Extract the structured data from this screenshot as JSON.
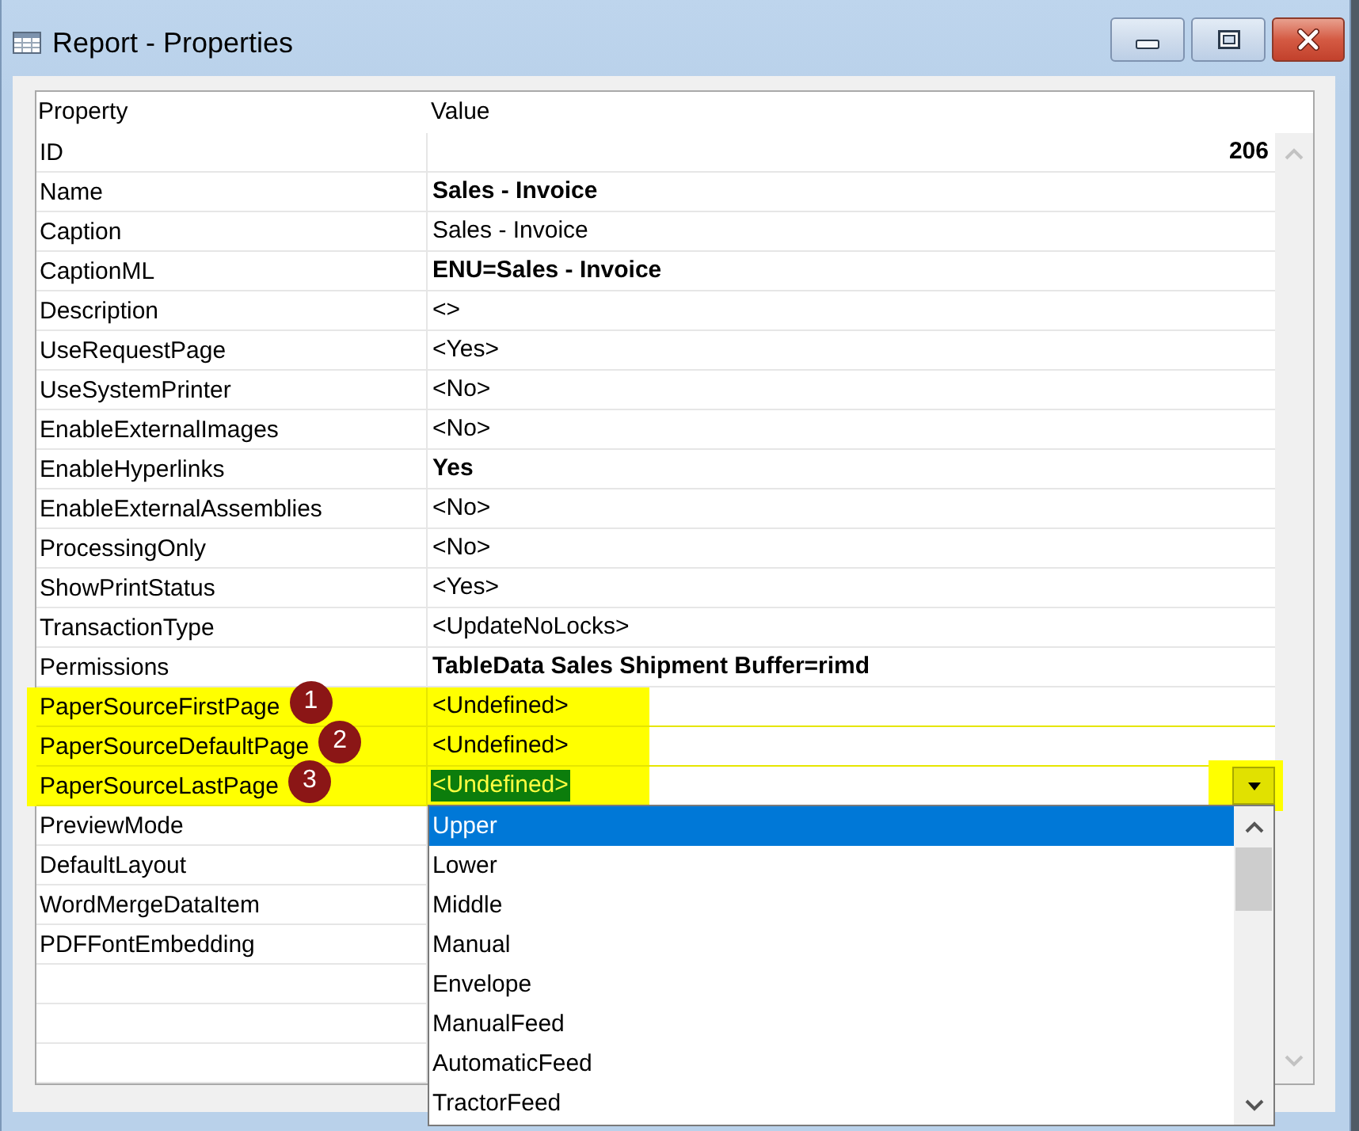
{
  "window": {
    "title": "Report - Properties"
  },
  "properties": {
    "columns": [
      "Property",
      "Value"
    ],
    "rows": [
      {
        "name": "ID",
        "value": "206",
        "kind": "number",
        "bold": true,
        "highlighted": false,
        "selected": false
      },
      {
        "name": "Name",
        "value": "Sales - Invoice",
        "kind": "text",
        "bold": true,
        "highlighted": false,
        "selected": false
      },
      {
        "name": "Caption",
        "value": "Sales - Invoice",
        "kind": "text",
        "bold": false,
        "highlighted": false,
        "selected": false
      },
      {
        "name": "CaptionML",
        "value": "ENU=Sales - Invoice",
        "kind": "text",
        "bold": true,
        "highlighted": false,
        "selected": false
      },
      {
        "name": "Description",
        "value": "<>",
        "kind": "text",
        "bold": false,
        "highlighted": false,
        "selected": false
      },
      {
        "name": "UseRequestPage",
        "value": "<Yes>",
        "kind": "text",
        "bold": false,
        "highlighted": false,
        "selected": false
      },
      {
        "name": "UseSystemPrinter",
        "value": "<No>",
        "kind": "text",
        "bold": false,
        "highlighted": false,
        "selected": false
      },
      {
        "name": "EnableExternalImages",
        "value": "<No>",
        "kind": "text",
        "bold": false,
        "highlighted": false,
        "selected": false
      },
      {
        "name": "EnableHyperlinks",
        "value": "Yes",
        "kind": "text",
        "bold": true,
        "highlighted": false,
        "selected": false
      },
      {
        "name": "EnableExternalAssemblies",
        "value": "<No>",
        "kind": "text",
        "bold": false,
        "highlighted": false,
        "selected": false
      },
      {
        "name": "ProcessingOnly",
        "value": "<No>",
        "kind": "text",
        "bold": false,
        "highlighted": false,
        "selected": false
      },
      {
        "name": "ShowPrintStatus",
        "value": "<Yes>",
        "kind": "text",
        "bold": false,
        "highlighted": false,
        "selected": false
      },
      {
        "name": "TransactionType",
        "value": "<UpdateNoLocks>",
        "kind": "text",
        "bold": false,
        "highlighted": false,
        "selected": false
      },
      {
        "name": "Permissions",
        "value": "TableData Sales Shipment Buffer=rimd",
        "kind": "text",
        "bold": true,
        "highlighted": false,
        "selected": false
      },
      {
        "name": "PaperSourceFirstPage",
        "value": "<Undefined>",
        "kind": "text",
        "bold": false,
        "highlighted": true,
        "marker": "1",
        "selected": false
      },
      {
        "name": "PaperSourceDefaultPage",
        "value": "<Undefined>",
        "kind": "text",
        "bold": false,
        "highlighted": true,
        "marker": "2",
        "selected": false
      },
      {
        "name": "PaperSourceLastPage",
        "value": "<Undefined>",
        "kind": "text",
        "bold": false,
        "highlighted": true,
        "marker": "3",
        "selected": true,
        "dropdown": {
          "expanded": true,
          "options": [
            {
              "label": "Upper",
              "selected": true
            },
            {
              "label": "Lower",
              "selected": false
            },
            {
              "label": "Middle",
              "selected": false
            },
            {
              "label": "Manual",
              "selected": false
            },
            {
              "label": "Envelope",
              "selected": false
            },
            {
              "label": "ManualFeed",
              "selected": false
            },
            {
              "label": "AutomaticFeed",
              "selected": false
            },
            {
              "label": "TractorFeed",
              "selected": false
            }
          ]
        }
      },
      {
        "name": "PreviewMode",
        "kind": "text",
        "highlighted": false,
        "selected": false
      },
      {
        "name": "DefaultLayout",
        "kind": "text",
        "highlighted": false,
        "selected": false
      },
      {
        "name": "WordMergeDataItem",
        "kind": "text",
        "highlighted": false,
        "selected": false
      },
      {
        "name": "PDFFontEmbedding",
        "kind": "text",
        "highlighted": false,
        "selected": false
      }
    ]
  }
}
